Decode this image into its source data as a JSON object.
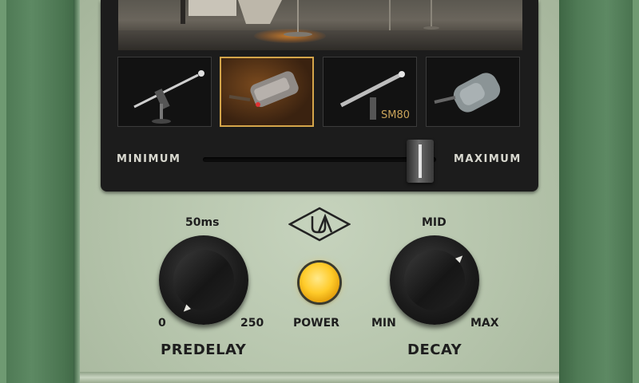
{
  "mic_selector": {
    "mics": [
      {
        "id": "mic-1",
        "caption": "",
        "selected": false
      },
      {
        "id": "mic-2",
        "caption": "",
        "selected": true
      },
      {
        "id": "mic-3",
        "caption": "SM80",
        "selected": false
      },
      {
        "id": "mic-4",
        "caption": "",
        "selected": false
      }
    ]
  },
  "distance_slider": {
    "min_label": "MINIMUM",
    "max_label": "MAXIMUM",
    "value": 0.93
  },
  "logo": {
    "icon": "ua-logo-icon"
  },
  "predelay": {
    "title": "PREDELAY",
    "top_label": "50ms",
    "min_label": "0",
    "max_label": "250"
  },
  "power": {
    "label": "POWER",
    "led_color": "#ffcb2a",
    "on": true
  },
  "decay": {
    "title": "DECAY",
    "top_label": "MID",
    "min_label": "MIN",
    "max_label": "MAX"
  },
  "colors": {
    "rail_green": "#5d8963",
    "face_cream": "#bccab2",
    "screen_dark": "#1c1c1c",
    "selected_border": "#d4a54a"
  }
}
